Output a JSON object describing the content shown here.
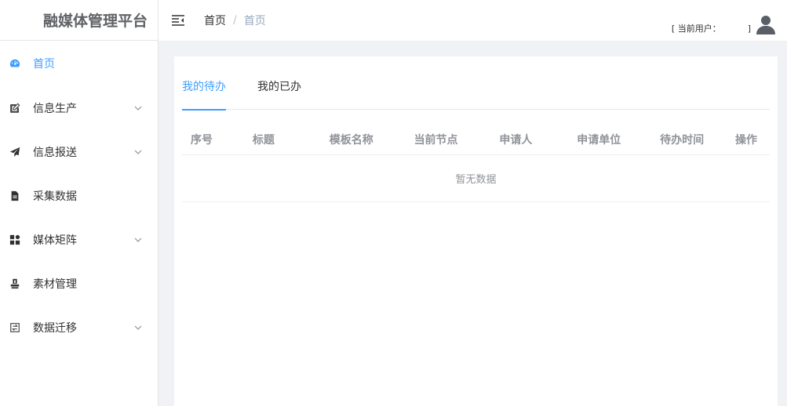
{
  "app": {
    "title": "融媒体管理平台"
  },
  "sidebar": {
    "items": [
      {
        "label": "首页",
        "icon": "dashboard-icon",
        "active": true,
        "has_submenu": false
      },
      {
        "label": "信息生产",
        "icon": "edit-icon",
        "active": false,
        "has_submenu": true
      },
      {
        "label": "信息报送",
        "icon": "send-icon",
        "active": false,
        "has_submenu": true
      },
      {
        "label": "采集数据",
        "icon": "document-icon",
        "active": false,
        "has_submenu": false
      },
      {
        "label": "媒体矩阵",
        "icon": "grid-icon",
        "active": false,
        "has_submenu": true
      },
      {
        "label": "素材管理",
        "icon": "stamp-icon",
        "active": false,
        "has_submenu": false
      },
      {
        "label": "数据迁移",
        "icon": "transfer-icon",
        "active": false,
        "has_submenu": true
      }
    ]
  },
  "header": {
    "breadcrumb": [
      "首页",
      "首页"
    ],
    "breadcrumb_separator": "/",
    "user_label_prefix": "[ 当前用户：",
    "user_label_suffix": "]"
  },
  "main": {
    "tabs": [
      {
        "label": "我的待办",
        "active": true
      },
      {
        "label": "我的已办",
        "active": false
      }
    ],
    "table": {
      "columns": [
        "序号",
        "标题",
        "模板名称",
        "当前节点",
        "申请人",
        "申请单位",
        "待办时间",
        "操作"
      ],
      "empty_text": "暂无数据"
    }
  },
  "colors": {
    "accent": "#409eff",
    "sidebar_bg": "#ffffff",
    "main_bg": "#f0f2f5",
    "muted_text": "#909399"
  }
}
